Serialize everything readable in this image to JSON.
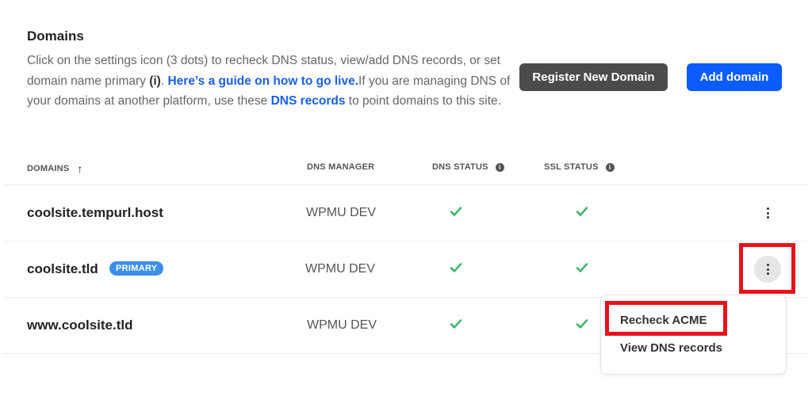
{
  "header": {
    "title": "Domains",
    "desc_part1": "Click on the settings icon (3 dots) to recheck DNS status, view/add DNS records, or set domain name primary ",
    "desc_info": "(i)",
    "desc_part2": ". ",
    "guide_link": "Here’s a guide on how to go live.",
    "desc_part3": "If you are managing DNS of your domains at another platform, use these ",
    "dns_link": "DNS records",
    "desc_part4": " to point domains to this site."
  },
  "buttons": {
    "register": "Register New Domain",
    "add": "Add domain"
  },
  "table": {
    "headers": {
      "domains": "DOMAINS",
      "sort_icon": "↑",
      "dns_manager": "DNS MANAGER",
      "dns_status": "DNS STATUS",
      "ssl_status": "SSL STATUS",
      "info_glyph": "i"
    },
    "rows": [
      {
        "domain": "coolsite.tempurl.host",
        "badge": "",
        "manager": "WPMU DEV",
        "dns_ok": true,
        "ssl_ok": true
      },
      {
        "domain": "coolsite.tld",
        "badge": "PRIMARY",
        "manager": "WPMU DEV",
        "dns_ok": true,
        "ssl_ok": true
      },
      {
        "domain": "www.coolsite.tld",
        "badge": "",
        "manager": "WPMU DEV",
        "dns_ok": true,
        "ssl_ok": true
      }
    ]
  },
  "menu": {
    "items": [
      "Recheck ACME",
      "View DNS records"
    ]
  },
  "colors": {
    "link": "#1a60e8",
    "check": "#2fb45a",
    "highlight": "#e8121b",
    "primary_badge": "#3b8fe8"
  },
  "icons": {
    "check": "check-icon",
    "kebab": "more-vertical-icon",
    "info": "info-icon",
    "sort": "arrow-up-icon"
  }
}
